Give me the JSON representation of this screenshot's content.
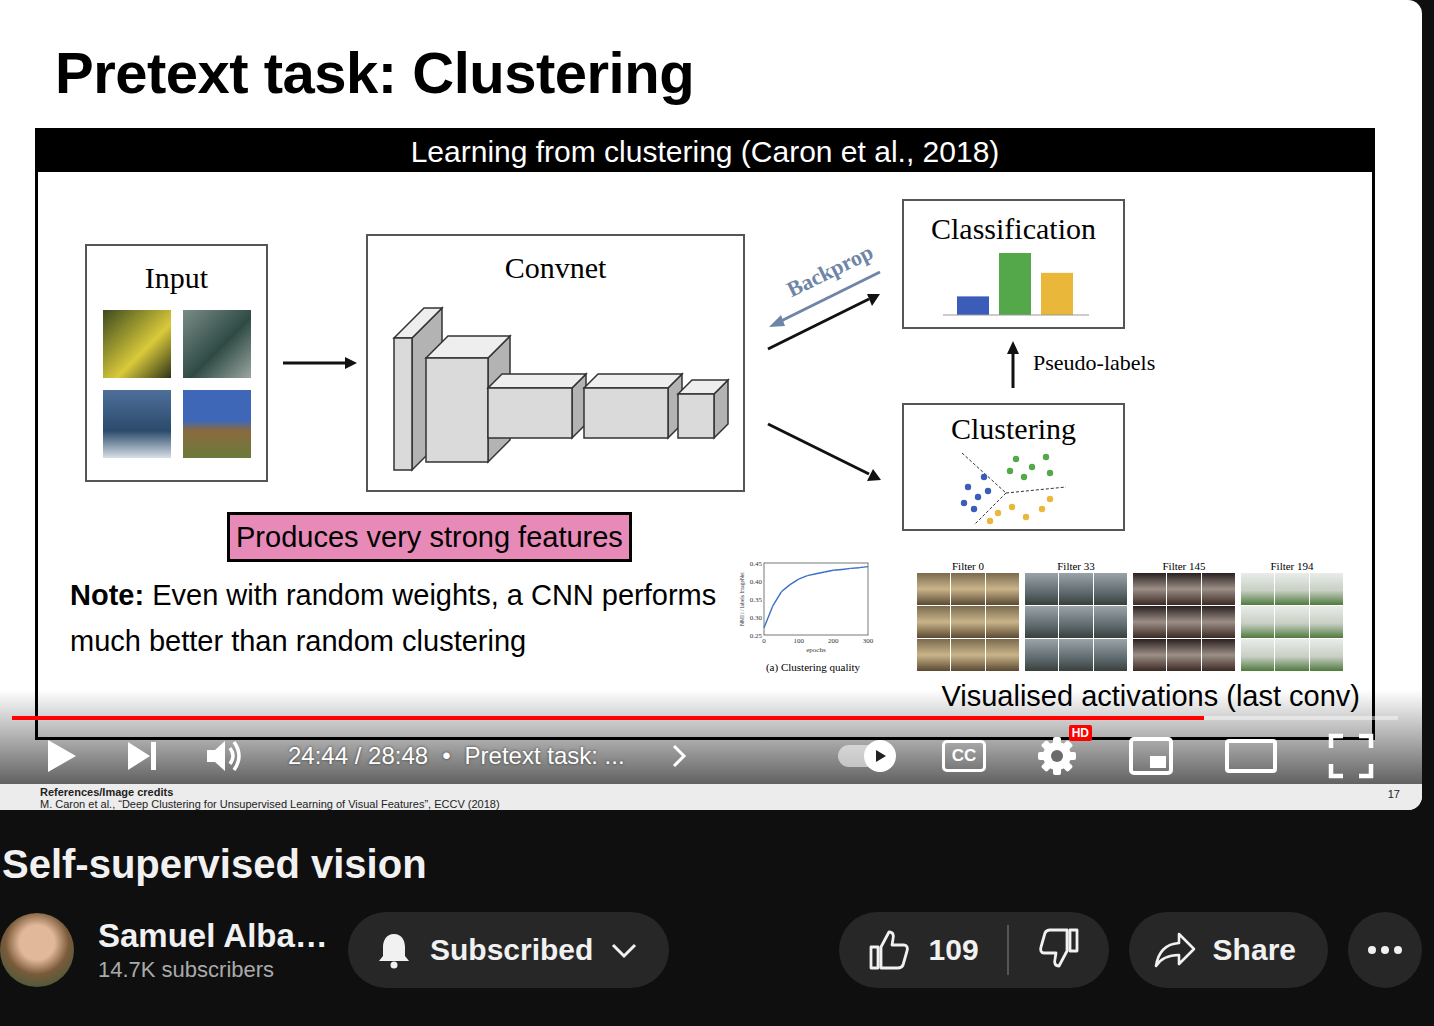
{
  "slide": {
    "title": "Pretext task: Clustering",
    "panel_title": "Learning from clustering (Caron et al., 2018)",
    "diagram": {
      "input_label": "Input",
      "convnet_label": "Convnet",
      "backprop_label": "Backprop",
      "classification_label": "Classification",
      "bars": [
        {
          "value": 0.3,
          "color": "#3b5cb8"
        },
        {
          "value": 1,
          "color": "#55a84a"
        },
        {
          "value": 0.68,
          "color": "#e9b73a"
        }
      ],
      "pseudo_labels_label": "Pseudo-labels",
      "clustering_label": "Clustering",
      "clusters": [
        {
          "color": "#3b5cb8",
          "points": [
            [
              14,
              40
            ],
            [
              24,
              50
            ],
            [
              10,
              56
            ],
            [
              30,
              30
            ],
            [
              20,
              62
            ],
            [
              34,
              44
            ]
          ]
        },
        {
          "color": "#55a84a",
          "points": [
            [
              62,
              12
            ],
            [
              78,
              20
            ],
            [
              92,
              10
            ],
            [
              70,
              30
            ],
            [
              56,
              24
            ],
            [
              96,
              26
            ]
          ]
        },
        {
          "color": "#e9b73a",
          "points": [
            [
              44,
              66
            ],
            [
              58,
              60
            ],
            [
              72,
              70
            ],
            [
              88,
              62
            ],
            [
              36,
              74
            ],
            [
              96,
              52
            ]
          ]
        }
      ]
    },
    "highlight": "Produces very strong features",
    "note_label": "Note:",
    "note_text": "Even with random weights, a CNN performs much better than random clustering",
    "chart": {
      "y_label": "NMI t / labels ImageNet",
      "y_ticks": [
        "0.45",
        "0.40",
        "0.35",
        "0.30",
        "0.25"
      ],
      "x_ticks": [
        "0",
        "100",
        "200",
        "300"
      ],
      "x_label": "epochs",
      "caption": "(a) Clustering quality",
      "epochs": [
        0,
        25,
        50,
        75,
        100,
        125,
        150,
        175,
        200,
        225,
        250,
        275,
        300
      ],
      "values": [
        0.27,
        0.33,
        0.37,
        0.39,
        0.405,
        0.415,
        0.42,
        0.425,
        0.43,
        0.432,
        0.435,
        0.437,
        0.44
      ]
    },
    "filters": [
      {
        "label": "Filter 0"
      },
      {
        "label": "Filter 33"
      },
      {
        "label": "Filter 145"
      },
      {
        "label": "Filter 194"
      }
    ],
    "filters_caption": "Visualised activations (last conv)",
    "references_label": "References/Image credits",
    "citation": "M. Caron et al., “Deep Clustering for Unsupervised Learning of Visual Features”, ECCV (2018)",
    "page_number": "17"
  },
  "player": {
    "progress": 0.86,
    "playing": false,
    "time": "24:44 / 28:48",
    "separator": "•",
    "chapter": "Pretext task: ...",
    "autoplay": true,
    "captions_label": "CC",
    "quality_badge": "HD"
  },
  "video": {
    "title": "Self-supervised vision",
    "channel": "Samuel Alba…",
    "subscribers": "14.7K subscribers",
    "subscribed": true,
    "subscribe_label": "Subscribed",
    "likes": "109",
    "share_label": "Share"
  }
}
